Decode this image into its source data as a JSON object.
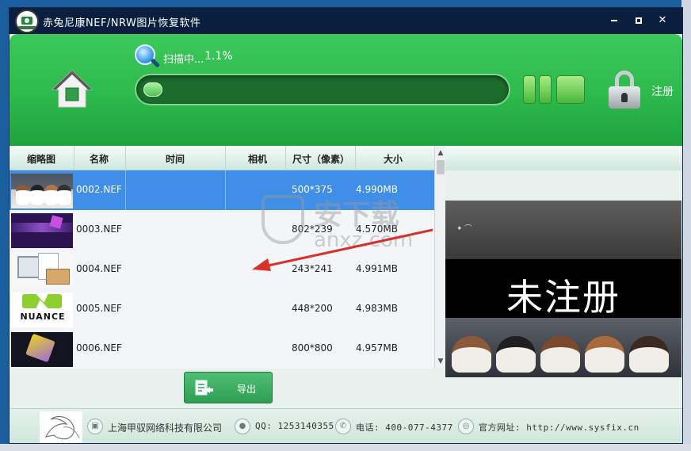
{
  "window": {
    "title": "赤兔尼康NEF/NRW图片恢复软件",
    "controls": {
      "minimize": "",
      "maximize": "",
      "close": "✕"
    }
  },
  "header": {
    "scan_label": "扫描中...",
    "scan_percent": "1.1%",
    "progress_fraction": 0.011,
    "register_label": "注册"
  },
  "table": {
    "columns": [
      "缩略图",
      "名称",
      "时间",
      "相机",
      "尺寸（像素）",
      "大小"
    ],
    "rows": [
      {
        "name": "0002.NEF",
        "time": "",
        "camera": "",
        "size": "500*375",
        "bytes": "4.990MB",
        "selected": true,
        "thumb": "puppies"
      },
      {
        "name": "0003.NEF",
        "time": "",
        "camera": "",
        "size": "802*239",
        "bytes": "4.570MB",
        "selected": false,
        "thumb": "windows-banner"
      },
      {
        "name": "0004.NEF",
        "time": "",
        "camera": "",
        "size": "243*241",
        "bytes": "4.991MB",
        "selected": false,
        "thumb": "files-monitor"
      },
      {
        "name": "0005.NEF",
        "time": "",
        "camera": "",
        "size": "448*200",
        "bytes": "4.983MB",
        "selected": false,
        "thumb": "nuance-logo"
      },
      {
        "name": "0006.NEF",
        "time": "",
        "camera": "",
        "size": "800*800",
        "bytes": "4.957MB",
        "selected": false,
        "thumb": "cube-logo"
      }
    ],
    "nuance_word": "NUANCE"
  },
  "preview": {
    "overlay_text": "未注册",
    "watermark_text": "安下载",
    "watermark_sub": "anxz.com"
  },
  "actions": {
    "export_label": "导出"
  },
  "footer": {
    "company": "上海甲驭网络科技有限公司",
    "qq": "QQ: 1253140355",
    "phone": "电话: 400-077-4377",
    "website": "官方网址: http://www.sysfix.cn"
  },
  "colors": {
    "header_green": "#2db94c",
    "selected_row": "#3f8fe8",
    "titlebar": "#0a1f3e"
  },
  "icons": {
    "home": "home-icon",
    "scan": "magnifier-icon",
    "pause": "pause-icon",
    "stop": "stop-icon",
    "lock": "lock-icon",
    "export": "export-icon"
  }
}
